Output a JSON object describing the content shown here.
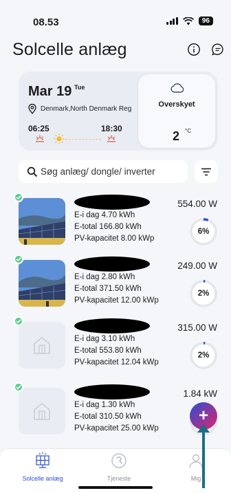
{
  "status_bar": {
    "time": "08.53",
    "battery": "96"
  },
  "header": {
    "title": "Solcelle anlæg",
    "info_icon": "info-icon",
    "chat_icon": "chat-icon"
  },
  "weather": {
    "date": "Mar 19",
    "day": "Tue",
    "location": "Denmark,North Denmark Reg",
    "sunrise": "06:25",
    "sunset": "18:30",
    "condition": "Overskyet",
    "temperature": "2",
    "unit": "°C"
  },
  "search": {
    "placeholder": "Søg anlæg/ dongle/ inverter"
  },
  "devices": [
    {
      "eday": "E-i dag 4.70 kWh",
      "etotal": "E-total 166.80 kWh",
      "capacity": "PV-kapacitet 8.00 kWp",
      "power": "554.00 W",
      "percent": "6%",
      "percent_value": 6,
      "image": "solar-panel"
    },
    {
      "eday": "E-i dag 2.80 kWh",
      "etotal": "E-total 371.50 kWh",
      "capacity": "PV-kapacitet 12.00 kWp",
      "power": "249.00 W",
      "percent": "2%",
      "percent_value": 2,
      "image": "solar-panel"
    },
    {
      "eday": "E-i dag 3.10 kWh",
      "etotal": "E-total 553.80 kWh",
      "capacity": "PV-kapacitet 12.04 kWp",
      "power": "315.00 W",
      "percent": "2%",
      "percent_value": 2,
      "image": "house-placeholder"
    },
    {
      "eday": "E-i dag 1.30 kWh",
      "etotal": "E-total 310.50 kWh",
      "capacity": "PV-kapacitet 25.00 kWp",
      "power": "1.84 kW",
      "percent": "",
      "percent_value": 7,
      "image": "house-placeholder"
    }
  ],
  "fab": {
    "label": "+"
  },
  "nav": [
    {
      "label": "Solcelle anlæg",
      "icon": "solar-panel-icon",
      "active": true
    },
    {
      "label": "Tjeneste",
      "icon": "service-icon",
      "active": false
    },
    {
      "label": "Mig",
      "icon": "profile-icon",
      "active": false
    }
  ],
  "colors": {
    "accent": "#2a4fd4",
    "check": "#5ccb8c",
    "fab_end": "#e0246b",
    "arrow": "#1c6e86"
  }
}
